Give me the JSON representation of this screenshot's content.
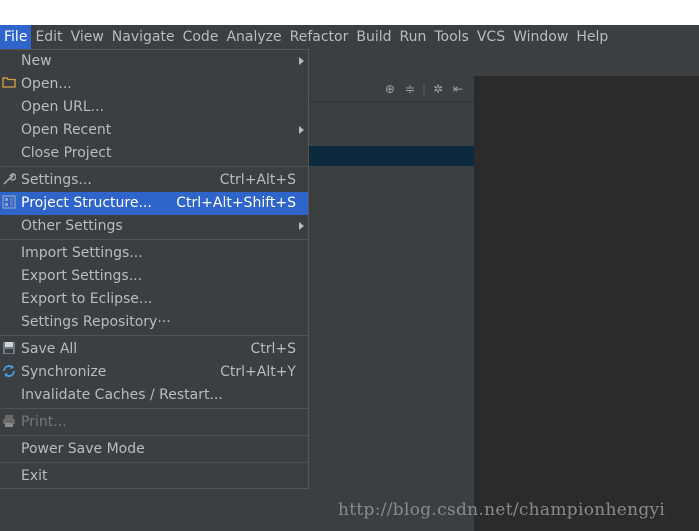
{
  "menubar": [
    {
      "label": "File",
      "active": true
    },
    {
      "label": "Edit"
    },
    {
      "label": "View"
    },
    {
      "label": "Navigate"
    },
    {
      "label": "Code"
    },
    {
      "label": "Analyze"
    },
    {
      "label": "Refactor"
    },
    {
      "label": "Build"
    },
    {
      "label": "Run"
    },
    {
      "label": "Tools"
    },
    {
      "label": "VCS"
    },
    {
      "label": "Window"
    },
    {
      "label": "Help"
    }
  ],
  "file_menu": {
    "new": {
      "label": "New"
    },
    "open": {
      "label": "Open...",
      "icon": "folder-icon"
    },
    "open_url": {
      "label": "Open URL..."
    },
    "open_recent": {
      "label": "Open Recent"
    },
    "close_project": {
      "label": "Close Project"
    },
    "settings": {
      "label": "Settings...",
      "shortcut": "Ctrl+Alt+S",
      "icon": "wrench-icon"
    },
    "project_structure": {
      "label": "Project Structure...",
      "shortcut": "Ctrl+Alt+Shift+S",
      "icon": "project-structure-icon"
    },
    "other_settings": {
      "label": "Other Settings"
    },
    "import_settings": {
      "label": "Import Settings..."
    },
    "export_settings": {
      "label": "Export Settings..."
    },
    "export_eclipse": {
      "label": "Export to Eclipse..."
    },
    "settings_repository": {
      "label": "Settings Repository···"
    },
    "save_all": {
      "label": "Save All",
      "shortcut": "Ctrl+S",
      "icon": "save-icon"
    },
    "synchronize": {
      "label": "Synchronize",
      "shortcut": "Ctrl+Alt+Y",
      "icon": "sync-icon"
    },
    "invalidate_caches": {
      "label": "Invalidate Caches / Restart..."
    },
    "print": {
      "label": "Print...",
      "icon": "printer-icon"
    },
    "power_save": {
      "label": "Power Save Mode"
    },
    "exit": {
      "label": "Exit"
    }
  },
  "watermark": "http://blog.csdn.net/championhengyi",
  "colors": {
    "selection": "#2f65ca",
    "menu_bg": "#3c3f41",
    "editor_bg": "#2b2b2b",
    "text": "#bbbbbb"
  }
}
